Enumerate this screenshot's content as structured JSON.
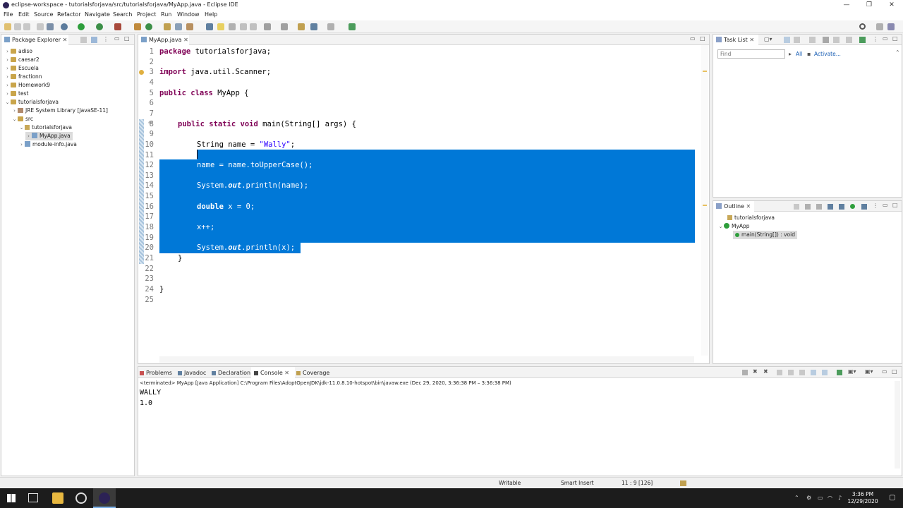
{
  "window": {
    "title": "eclipse-workspace - tutorialsforjava/src/tutorialsforjava/MyApp.java - Eclipse IDE",
    "minimize": "—",
    "maximize": "❐",
    "close": "✕"
  },
  "menu": [
    "File",
    "Edit",
    "Source",
    "Refactor",
    "Navigate",
    "Search",
    "Project",
    "Run",
    "Window",
    "Help"
  ],
  "package_explorer": {
    "tab_label": "Package Explorer",
    "items": [
      {
        "label": "adiso"
      },
      {
        "label": "caesar2"
      },
      {
        "label": "Escuela"
      },
      {
        "label": "fractionn"
      },
      {
        "label": "Homework9"
      },
      {
        "label": "test"
      },
      {
        "label": "tutorialsforjava"
      },
      {
        "label": "JRE System Library [JavaSE-11]"
      },
      {
        "label": "src"
      },
      {
        "label": "tutorialsforjava"
      },
      {
        "label": "MyApp.java"
      },
      {
        "label": "module-info.java"
      }
    ]
  },
  "editor": {
    "tab_label": "MyApp.java",
    "line_numbers": [
      "1",
      "2",
      "3",
      "4",
      "5",
      "6",
      "7",
      "8",
      "9",
      "10",
      "11",
      "12",
      "13",
      "14",
      "15",
      "16",
      "17",
      "18",
      "19",
      "20",
      "21",
      "22",
      "23",
      "24",
      "25"
    ],
    "folding": {
      "line3": "3",
      "line8": "8"
    },
    "code": {
      "l1_kw": "package",
      "l1_rest": " tutorialsforjava;",
      "l3_kw": "import",
      "l3_rest": " java.util.Scanner;",
      "l5_kw1": "public",
      "l5_kw2": "class",
      "l5_rest": " MyApp {",
      "l8_kw1": "public",
      "l8_kw2": "static",
      "l8_kw3": "void",
      "l8_rest": " main(String[] args) {",
      "l10_a": "String name = ",
      "l10_str": "\"Wally\"",
      "l10_b": ";",
      "l12": "name = name.toUpperCase();",
      "l14_a": "System.",
      "l14_it": "out",
      "l14_b": ".println(name);",
      "l16_kw": "double",
      "l16_rest": " x = 0;",
      "l18": "x++;",
      "l20_a": "System.",
      "l20_it": "out",
      "l20_b": ".println(x);",
      "l21": "}",
      "l24": "}"
    }
  },
  "task_list": {
    "tab_label": "Task List",
    "find_placeholder": "Find",
    "all_label": "All",
    "activate_label": "Activate..."
  },
  "outline": {
    "tab_label": "Outline",
    "items": [
      {
        "label": "tutorialsforjava"
      },
      {
        "label": "MyApp"
      },
      {
        "label": "main(String[]) : void"
      }
    ]
  },
  "bottom_tabs": [
    "Problems",
    "Javadoc",
    "Declaration",
    "Console",
    "Coverage"
  ],
  "console": {
    "header": "<terminated> MyApp [Java Application] C:\\Program Files\\AdoptOpenJDK\\jdk-11.0.8.10-hotspot\\bin\\javaw.exe  (Dec 29, 2020, 3:36:38 PM – 3:36:38 PM)",
    "lines": [
      "WALLY",
      "1.0"
    ]
  },
  "status": {
    "writable": "Writable",
    "insert_mode": "Smart Insert",
    "position": "11 : 9 [126]"
  },
  "taskbar": {
    "time": "3:36 PM",
    "date": "12/29/2020"
  },
  "colors": {
    "selection": "#0078d7",
    "keyword": "#7f0055",
    "string": "#2a00ff"
  }
}
